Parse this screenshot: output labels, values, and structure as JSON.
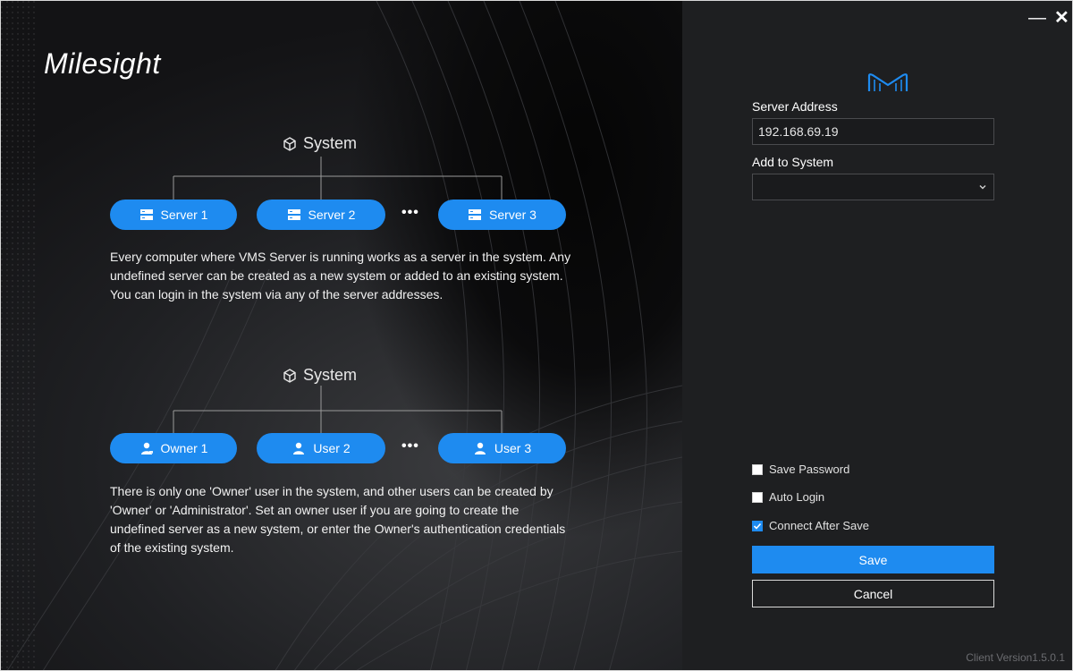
{
  "brand": {
    "logo_text": "Milesight"
  },
  "window": {
    "minimize_glyph": "—",
    "close_glyph": "✕"
  },
  "diagram1": {
    "title": "System",
    "nodes": [
      "Server 1",
      "Server 2",
      "Server 3"
    ],
    "ellipsis": "•••",
    "description": "Every computer where VMS Server is running works as a server in the system. Any undefined server can be created as a new system or added to an existing system. You can login in the system via any of the server addresses."
  },
  "diagram2": {
    "title": "System",
    "nodes": [
      "Owner 1",
      "User 2",
      "User 3"
    ],
    "ellipsis": "•••",
    "description": "There is only one 'Owner' user in the system, and other users can be created by 'Owner' or 'Administrator'. Set an owner user if you are going to create the undefined server as a new system, or enter the Owner's authentication credentials of the existing system."
  },
  "form": {
    "server_address_label": "Server Address",
    "server_address_value": "192.168.69.19",
    "add_to_system_label": "Add to System",
    "add_to_system_value": "",
    "save_password_label": "Save Password",
    "save_password_checked": false,
    "auto_login_label": "Auto Login",
    "auto_login_checked": false,
    "connect_after_save_label": "Connect After Save",
    "connect_after_save_checked": true,
    "save_label": "Save",
    "cancel_label": "Cancel"
  },
  "footer": {
    "version": "Client Version1.5.0.1"
  },
  "colors": {
    "accent": "#1e8bf0",
    "panel_bg": "#1e1f21"
  }
}
